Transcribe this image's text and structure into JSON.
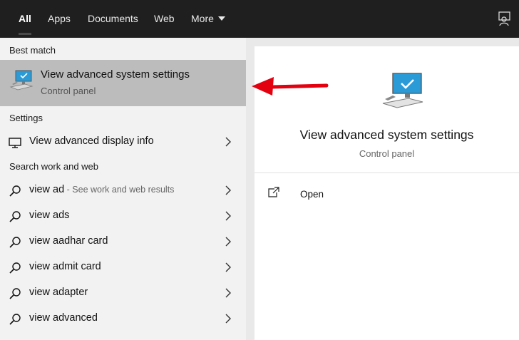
{
  "tabs": {
    "all": "All",
    "apps": "Apps",
    "documents": "Documents",
    "web": "Web",
    "more": "More"
  },
  "left": {
    "best_match_heading": "Best match",
    "best_match": {
      "title": "View advanced system settings",
      "subtitle": "Control panel",
      "icon": "computer-check-icon"
    },
    "settings_heading": "Settings",
    "settings_item": {
      "label": "View advanced display info",
      "icon": "monitor-icon"
    },
    "search_heading": "Search work and web",
    "search_items": [
      {
        "prefix": "view ",
        "bold": "ad",
        "hint": " - See work and web results"
      },
      {
        "prefix": "view ",
        "bold": "ads",
        "hint": ""
      },
      {
        "prefix": "view ",
        "bold": "aadhar card",
        "hint": ""
      },
      {
        "prefix": "view ",
        "bold": "admit card",
        "hint": ""
      },
      {
        "prefix": "view ",
        "bold": "adapter",
        "hint": ""
      },
      {
        "prefix": "view ",
        "bold": "advanced",
        "hint": ""
      }
    ]
  },
  "right": {
    "title": "View advanced system settings",
    "subtitle": "Control panel",
    "open_label": "Open"
  },
  "colors": {
    "accent_red": "#e3000f",
    "selection_gray": "#bcbcbc",
    "topbar": "#1f1f1f"
  }
}
